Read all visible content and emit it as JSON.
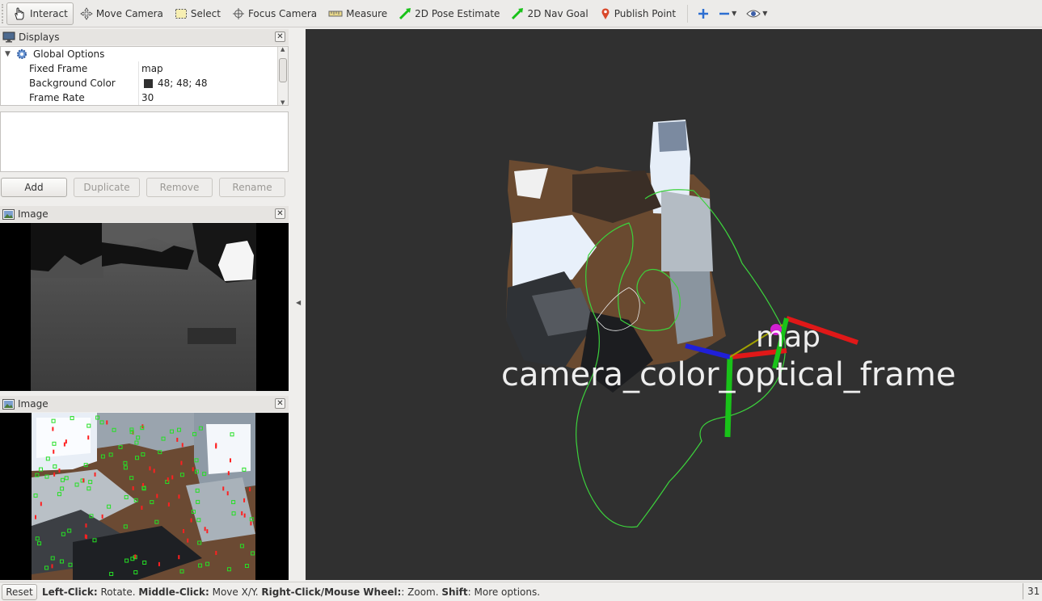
{
  "toolbar": {
    "interact": "Interact",
    "move_camera": "Move Camera",
    "select": "Select",
    "focus_camera": "Focus Camera",
    "measure": "Measure",
    "pose_estimate": "2D Pose Estimate",
    "nav_goal": "2D Nav Goal",
    "publish_point": "Publish Point"
  },
  "displays": {
    "title": "Displays",
    "global_options": "Global Options",
    "rows": [
      {
        "name": "Fixed Frame",
        "value": "map"
      },
      {
        "name": "Background Color",
        "value": "48; 48; 48",
        "swatch": "#303030"
      },
      {
        "name": "Frame Rate",
        "value": "30"
      }
    ],
    "buttons": {
      "add": "Add",
      "duplicate": "Duplicate",
      "remove": "Remove",
      "rename": "Rename"
    }
  },
  "image_panels": [
    {
      "title": "Image"
    },
    {
      "title": "Image"
    }
  ],
  "view": {
    "frame_label_map": "map",
    "frame_label_camera": "camera_color_optical_frame",
    "background": "#303030",
    "trajectory_color": "#3cd23c"
  },
  "status": {
    "reset": "Reset",
    "left_click_label": "Left-Click:",
    "left_click_desc": " Rotate. ",
    "middle_click_label": "Middle-Click:",
    "middle_click_desc": " Move X/Y. ",
    "right_click_label": "Right-Click/Mouse Wheel:",
    "right_click_desc": ": Zoom. ",
    "shift_label": "Shift",
    "shift_desc": ": More options.",
    "fps": "31"
  }
}
